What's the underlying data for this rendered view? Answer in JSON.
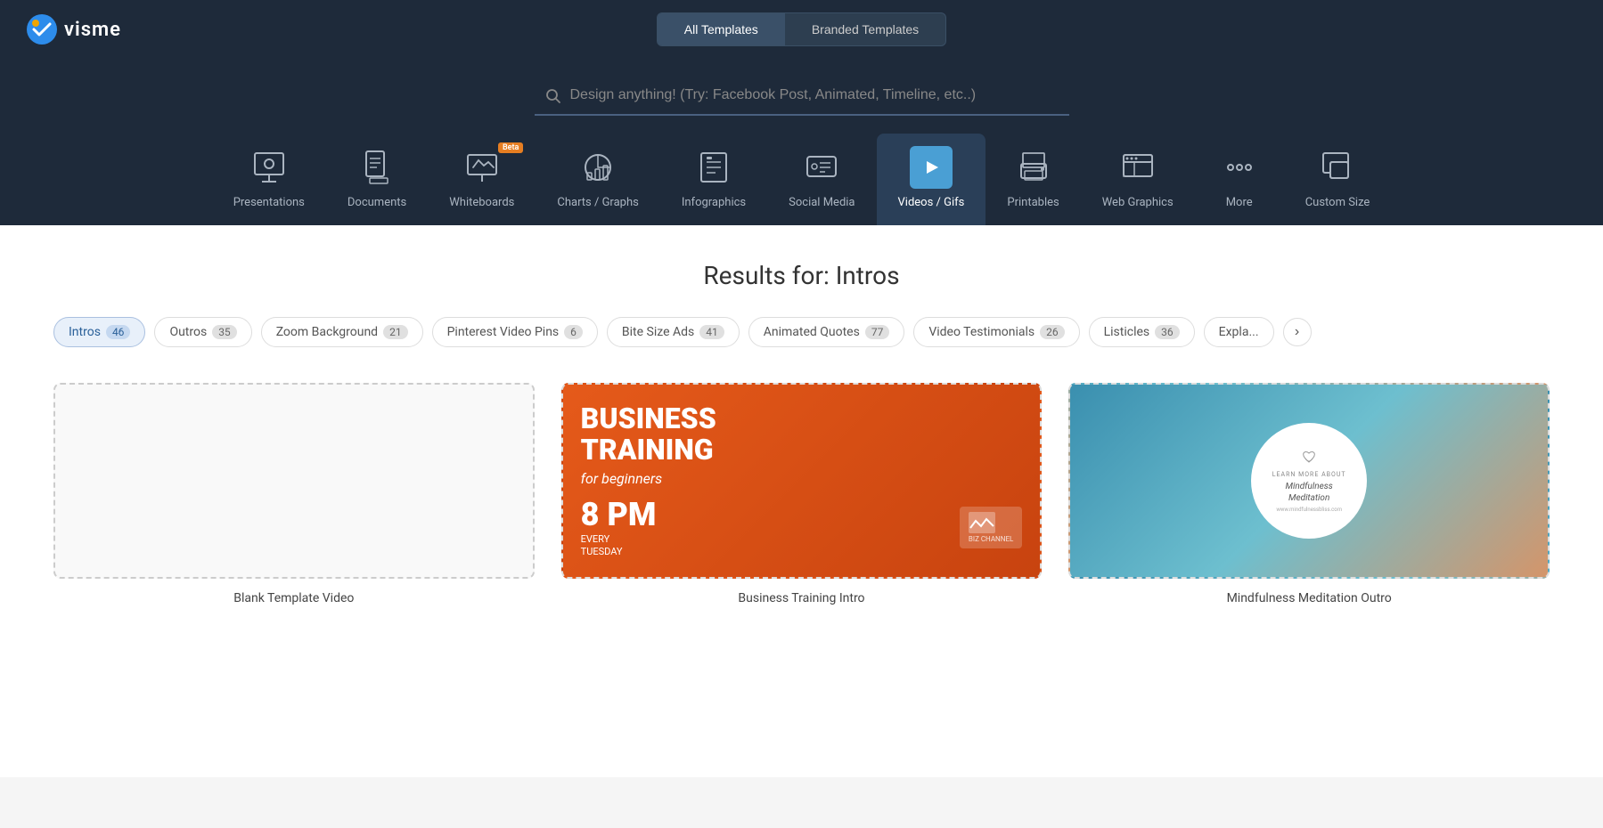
{
  "header": {
    "logo_text": "visme",
    "tabs": [
      {
        "id": "all-templates",
        "label": "All Templates",
        "active": true
      },
      {
        "id": "branded-templates",
        "label": "Branded Templates",
        "active": false
      }
    ]
  },
  "search": {
    "placeholder": "Design anything! (Try: Facebook Post, Animated, Timeline, etc..)"
  },
  "categories": [
    {
      "id": "presentations",
      "label": "Presentations",
      "active": false,
      "icon": "presentation"
    },
    {
      "id": "documents",
      "label": "Documents",
      "active": false,
      "icon": "document"
    },
    {
      "id": "whiteboards",
      "label": "Whiteboards",
      "active": false,
      "icon": "whiteboard",
      "beta": true
    },
    {
      "id": "charts-graphs",
      "label": "Charts / Graphs",
      "active": false,
      "icon": "chart"
    },
    {
      "id": "infographics",
      "label": "Infographics",
      "active": false,
      "icon": "infographic"
    },
    {
      "id": "social-media",
      "label": "Social Media",
      "active": false,
      "icon": "social"
    },
    {
      "id": "videos-gifs",
      "label": "Videos / Gifs",
      "active": true,
      "icon": "video"
    },
    {
      "id": "printables",
      "label": "Printables",
      "active": false,
      "icon": "print"
    },
    {
      "id": "web-graphics",
      "label": "Web Graphics",
      "active": false,
      "icon": "web"
    },
    {
      "id": "more",
      "label": "More",
      "active": false,
      "icon": "more"
    },
    {
      "id": "custom-size",
      "label": "Custom Size",
      "active": false,
      "icon": "custom"
    }
  ],
  "results": {
    "title": "Results for: Intros"
  },
  "filters": [
    {
      "id": "intros",
      "label": "Intros",
      "count": 46,
      "active": true
    },
    {
      "id": "outros",
      "label": "Outros",
      "count": 35,
      "active": false
    },
    {
      "id": "zoom-background",
      "label": "Zoom Background",
      "count": 21,
      "active": false
    },
    {
      "id": "pinterest-video-pins",
      "label": "Pinterest Video Pins",
      "count": 6,
      "active": false
    },
    {
      "id": "bite-size-ads",
      "label": "Bite Size Ads",
      "count": 41,
      "active": false
    },
    {
      "id": "animated-quotes",
      "label": "Animated Quotes",
      "count": 77,
      "active": false
    },
    {
      "id": "video-testimonials",
      "label": "Video Testimonials",
      "count": 26,
      "active": false
    },
    {
      "id": "listicles",
      "label": "Listicles",
      "count": 36,
      "active": false
    },
    {
      "id": "expla",
      "label": "Expla...",
      "count": null,
      "active": false
    }
  ],
  "templates": [
    {
      "id": "blank-template",
      "name": "Blank Template Video",
      "type": "blank"
    },
    {
      "id": "business-training",
      "name": "Business Training Intro",
      "type": "business-training",
      "title_line1": "BUSINESS",
      "title_line2": "TRAINING",
      "subtitle": "for beginners",
      "time": "8 PM",
      "schedule": "EVERY\nTUESDAY"
    },
    {
      "id": "mindfulness-meditation",
      "name": "Mindfulness Meditation Outro",
      "type": "mindfulness",
      "learn_more": "LEARN MORE ABOUT",
      "title": "Mindfulness Meditation",
      "url": "www.mindfulnessbliss.com"
    }
  ],
  "next_button_label": "›"
}
